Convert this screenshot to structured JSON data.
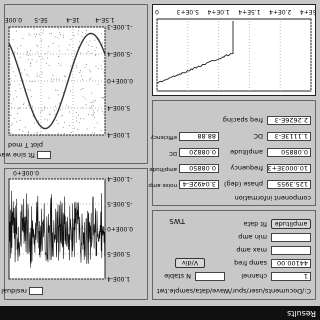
{
  "window": {
    "title": "Results"
  },
  "params": {
    "path_label": "C:/Documents/user/spur/Wave/data/sample.twt",
    "row1": {
      "label_a": "channel",
      "value_a": "1",
      "label_b": "N stable",
      "value_b": ""
    },
    "row2": {
      "label_a": "samp freq",
      "value_a": "44100.00",
      "unit": "V/div"
    },
    "row3": {
      "label_a": "max amp",
      "value_a": ""
    },
    "row4": {
      "label_a": "min amp",
      "value_a": ""
    },
    "row5": {
      "label_a": "fit data",
      "value_a": "amplitude"
    },
    "mode_label": "TWS",
    "units_label": "V/div"
  },
  "components": {
    "title": "component information",
    "rows": [
      {
        "label": "phase (deg)",
        "value": "125.3955"
      },
      {
        "label": "frequency",
        "value": "10.0003E+3"
      },
      {
        "label": "amplitude",
        "value": "0.08850"
      },
      {
        "label": "DC",
        "value": "1.1113E-3"
      },
      {
        "label": "freq spacing",
        "value": "2.2626E-3"
      }
    ],
    "right_rows": [
      {
        "label": "noise amp",
        "value": "3.0492E-4"
      },
      {
        "label": "amplitude",
        "value": "0.08850"
      },
      {
        "label": "DC",
        "value": "0.08820"
      },
      {
        "label": "efficiency",
        "value": "88.88"
      }
    ]
  },
  "residual_plot": {
    "legend_label": "residual",
    "x_ticks": [
      "0.00E+0",
      "",
      "",
      ""
    ],
    "y_ticks": [
      "1.00E-4",
      "5.00E-5",
      "0.00E+0",
      "-5.00E-5",
      "-1.00E-4"
    ]
  },
  "wave_plot": {
    "legend_label": "fit sine wave",
    "legend_label2": "plot T mod",
    "x_ticks": [
      "0.00E+0",
      "5E-5",
      "1E-4",
      "1.5E-4"
    ],
    "y_ticks": [
      "1.00E-4",
      "5.00E-4",
      "0.00E+0",
      "-5.00E-4",
      "-1.00E-3"
    ]
  },
  "decay_plot": {
    "x_ticks": [
      "0",
      "5.0E+3",
      "1.0E+4",
      "1.5E+4",
      "2.0E+4",
      "2.5E+4"
    ]
  }
}
